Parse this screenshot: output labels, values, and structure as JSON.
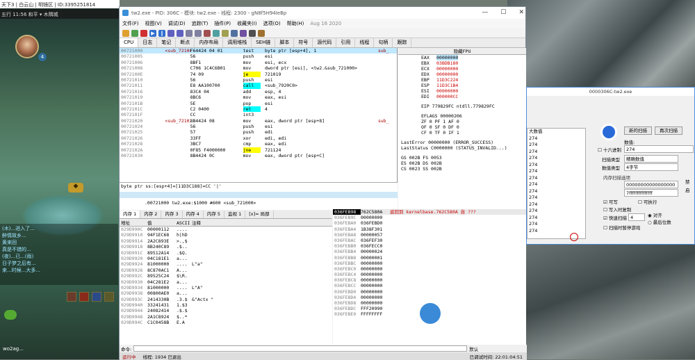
{
  "game": {
    "title": "天下3 | 白云山 | 明镜区 | ID:3395251814",
    "top_bar": "五行 11:56  和平 ▾  木隅城",
    "level": "4",
    "chat": [
      "(木)...进入了...",
      "醉情故乡...",
      "黄来回",
      "真是不错的...",
      "(夜)...已...(雨)",
      "日子梦之后有...",
      "来...时候...大多..."
    ],
    "player_name": "wo2ag..."
  },
  "dbg": {
    "title": "tw2.exe - PID: 306C - 模块: tw2.exe - 线程: 2300 - gN8f5H94IeBp",
    "date": "Aug 16 2020",
    "menu": [
      "文件(F)",
      "视图(V)",
      "调试(D)",
      "追踪(T)",
      "插件(P)",
      "收藏夹(I)",
      "选项(O)",
      "帮助(H)"
    ],
    "tabs": [
      "CPU",
      "日志",
      "笔记",
      "断点",
      "内存布局",
      "调用堆栈",
      "SEH链",
      "脚本",
      "符号",
      "源代码",
      "引用",
      "线程",
      "句柄",
      "跟踪"
    ],
    "disasm": [
      {
        "addr": "00721000",
        "label": "<sub_72100",
        "bytes": "F64424 04 01",
        "op": "test",
        "args": "byte ptr [esp+4], 1",
        "sub": "sub_",
        "sel": true,
        "hl": ""
      },
      {
        "addr": "00721005",
        "label": "",
        "bytes": "56",
        "op": "push",
        "args": "esi",
        "sub": "",
        "sel": false,
        "hl": ""
      },
      {
        "addr": "00721006",
        "label": "",
        "bytes": "8BF1",
        "op": "mov",
        "args": "esi, ecx",
        "sub": "",
        "sel": false,
        "hl": ""
      },
      {
        "addr": "00721008",
        "label": "",
        "bytes": "C706 1C4C6B01",
        "op": "mov",
        "args": "dword ptr [esi], <tw2.&sub_721000>",
        "sub": "",
        "sel": false,
        "hl": ""
      },
      {
        "addr": "0072100E",
        "label": "",
        "bytes": "74 09",
        "op": "je",
        "args": "721019",
        "sub": "",
        "sel": false,
        "hl": "j"
      },
      {
        "addr": "00721010",
        "label": "",
        "bytes": "56",
        "op": "push",
        "args": "esi",
        "sub": "",
        "sel": false,
        "hl": ""
      },
      {
        "addr": "00721011",
        "label": "",
        "bytes": "E8 AA100700",
        "op": "call",
        "args": "<sub_7920C0>",
        "sub": "",
        "sel": false,
        "hl": "call"
      },
      {
        "addr": "00721016",
        "label": "",
        "bytes": "83C4 04",
        "op": "add",
        "args": "esp, 4",
        "sub": "",
        "sel": false,
        "hl": ""
      },
      {
        "addr": "00721019",
        "label": "",
        "bytes": "8BC6",
        "op": "mov",
        "args": "eax, esi",
        "sub": "",
        "sel": false,
        "hl": ""
      },
      {
        "addr": "0072101B",
        "label": "",
        "bytes": "5E",
        "op": "pop",
        "args": "esi",
        "sub": "",
        "sel": false,
        "hl": ""
      },
      {
        "addr": "0072101C",
        "label": "",
        "bytes": "C2 0400",
        "op": "ret",
        "args": "4",
        "sub": "",
        "sel": false,
        "hl": "ret"
      },
      {
        "addr": "0072101F",
        "label": "",
        "bytes": "CC",
        "op": "int3",
        "args": "",
        "sub": "",
        "sel": false,
        "hl": ""
      },
      {
        "addr": "00721020",
        "label": "<sub_72102",
        "bytes": "8B4424 08",
        "op": "mov",
        "args": "eax, dword ptr [esp+8]",
        "sub": "sub_",
        "sel": false,
        "hl": ""
      },
      {
        "addr": "00721024",
        "label": "",
        "bytes": "56",
        "op": "push",
        "args": "esi",
        "sub": "",
        "sel": false,
        "hl": ""
      },
      {
        "addr": "00721025",
        "label": "",
        "bytes": "57",
        "op": "push",
        "args": "edi",
        "sub": "",
        "sel": false,
        "hl": ""
      },
      {
        "addr": "00721026",
        "label": "",
        "bytes": "33FF",
        "op": "xor",
        "args": "edi, edi",
        "sub": "",
        "sel": false,
        "hl": ""
      },
      {
        "addr": "00721028",
        "label": "",
        "bytes": "3BC7",
        "op": "cmp",
        "args": "eax, edi",
        "sub": "",
        "sel": false,
        "hl": ""
      },
      {
        "addr": "0072102A",
        "label": "",
        "bytes": "0F85 F4000000",
        "op": "jne",
        "args": "721124",
        "sub": "",
        "sel": false,
        "hl": "j"
      },
      {
        "addr": "00721030",
        "label": "",
        "bytes": "8B4424 0C",
        "op": "mov",
        "args": "eax, dword ptr [esp+C]",
        "sub": "",
        "sel": false,
        "hl": ""
      }
    ],
    "regs_header": "隐藏FPU",
    "regs": [
      {
        "n": "EAX",
        "v": "00000000"
      },
      {
        "n": "EBX",
        "v": "03BDB180"
      },
      {
        "n": "ECX",
        "v": "00000000"
      },
      {
        "n": "EDX",
        "v": "00000000"
      },
      {
        "n": "EBP",
        "v": "11D3C224"
      },
      {
        "n": "ESP",
        "v": "11D3C1B4"
      },
      {
        "n": "ESI",
        "v": "00000000"
      },
      {
        "n": "EDI",
        "v": "000000CC"
      }
    ],
    "eip": "EIP     779829FC     ntdll.779829FC",
    "eflags": "EFLAGS    00000206",
    "flags": [
      "ZF 0  PF 1  AF 0",
      "OF 0  SF 0  DF 0",
      "CF 0  TF 0  IF 1"
    ],
    "lasterror": "LastError   00000000 (ERROR_SUCCESS)",
    "laststatus": "LastStatus  C0000000 (STATUS_INVALID...)",
    "segs": [
      "GS 002B  FS 0053",
      "ES 002B  DS 002B",
      "CS 0023  SS 002B"
    ],
    "info1": "byte ptr ss:[esp+4]=[11D3C188]=CC '|'",
    "info2": ".00721000 tw2.exe:$1000 #600 <sub_721000>",
    "dump_tabs": [
      "内存 1",
      "内存 2",
      "内存 3",
      "内存 4",
      "内存 5",
      "监视 1",
      "[x]= 局部"
    ],
    "dump_head": [
      "地址",
      "值",
      "ASCII",
      "注释"
    ],
    "dump": [
      {
        "a": "029D990C",
        "h": "00000112",
        "s": "....",
        "c": ""
      },
      {
        "a": "029D9910",
        "h": "94F1EC68",
        "s": "h|hD",
        "c": ""
      },
      {
        "a": "029D9914",
        "h": "2A2C893E",
        "s": ">.,$",
        "c": ""
      },
      {
        "a": "029D9918",
        "h": "8B240C89",
        "s": ".$..",
        "c": ""
      },
      {
        "a": "029D991C",
        "h": "89512A14",
        "s": ".$Q.",
        "c": ""
      },
      {
        "a": "029D9920",
        "h": "04C181E1",
        "s": "a...",
        "c": ""
      },
      {
        "a": "029D9924",
        "h": "81000000",
        "s": "....",
        "c": "L\"a\""
      },
      {
        "a": "029D9928",
        "h": "8C870AC1",
        "s": "A...",
        "c": ""
      },
      {
        "a": "029D992C",
        "h": "89525C24",
        "s": "$\\R.",
        "c": ""
      },
      {
        "a": "029D9930",
        "h": "04C281E2",
        "s": "a...",
        "c": ""
      },
      {
        "a": "029D9934",
        "h": "81000000",
        "s": "....",
        "c": "L\"A\""
      },
      {
        "a": "029D9938",
        "h": "00800AE0",
        "s": "a...",
        "c": ""
      },
      {
        "a": "029D993C",
        "h": "2414330B",
        "s": ".3.$",
        "c": "&\"Actx \""
      },
      {
        "a": "029D9940",
        "h": "33241431",
        "s": "1.$3",
        "c": ""
      },
      {
        "a": "029D9944",
        "h": "24082414",
        "s": ".$.$",
        "c": ""
      },
      {
        "a": "029D9948",
        "h": "2A1C8924",
        "s": "$..*",
        "c": ""
      },
      {
        "a": "029D994C",
        "h": "C1C0458B",
        "s": "E.A",
        "c": ""
      }
    ],
    "stack": [
      {
        "a": "036FEB98",
        "v": "762C580A",
        "c": "返回到 kernelbase.762C580A 自 ???"
      },
      {
        "a": "036FEB9C",
        "v": "00000000",
        "c": ""
      },
      {
        "a": "036FEBA0",
        "v": "036FEBD0",
        "c": ""
      },
      {
        "a": "036FEBA4",
        "v": "1B38F301",
        "c": ""
      },
      {
        "a": "036FEBA8",
        "v": "00000057",
        "c": ""
      },
      {
        "a": "036FEBAC",
        "v": "036FEF30",
        "c": ""
      },
      {
        "a": "036FEBB0",
        "v": "036FECC0",
        "c": ""
      },
      {
        "a": "036FEBB4",
        "v": "00000024",
        "c": ""
      },
      {
        "a": "036FEBB8",
        "v": "00000001",
        "c": ""
      },
      {
        "a": "036FEBBC",
        "v": "00000000",
        "c": ""
      },
      {
        "a": "036FEBC0",
        "v": "00000000",
        "c": ""
      },
      {
        "a": "036FEBC4",
        "v": "00000000",
        "c": ""
      },
      {
        "a": "036FEBC8",
        "v": "00000000",
        "c": ""
      },
      {
        "a": "036FEBCC",
        "v": "00000000",
        "c": ""
      },
      {
        "a": "036FEBD0",
        "v": "00000000",
        "c": ""
      },
      {
        "a": "036FEBD4",
        "v": "00000000",
        "c": ""
      },
      {
        "a": "036FEBD8",
        "v": "00000000",
        "c": ""
      },
      {
        "a": "036FEBDC",
        "v": "FFF20990",
        "c": ""
      },
      {
        "a": "036FEBE0",
        "v": "FFFFFFFF",
        "c": ""
      }
    ],
    "cmd_label": "命令:",
    "cmd_default": "默认",
    "status": [
      "运行中",
      "线程: 1934 已退出"
    ],
    "status_right": "已调试时间: 22:01:04:51"
  },
  "ce": {
    "title": "0000306C-tw2.exe",
    "results": [
      "大数值",
      "274",
      "274",
      "274",
      "274",
      "274",
      "274",
      "274",
      "274",
      "274",
      "274",
      "274",
      "274",
      "274",
      "274",
      "274"
    ],
    "first_scan": "新的扫描",
    "next_scan": "再次扫描",
    "value_label": "数值:",
    "hex_label": "十六进制",
    "value": "274",
    "scan_type_label": "扫描类型",
    "scan_type": "精确数值",
    "value_type_label": "数值类型",
    "value_type": "4字节",
    "mem_opts": "内存扫描选项",
    "start": "00000000000000000",
    "stop": "7fffffffffffffff",
    "writable": "可写",
    "executable": "可执行",
    "copyonwrite": "写入时复制",
    "fast_scan": "快速扫描",
    "fast_val": "4",
    "align": "对齐",
    "last_digits": "最后位数",
    "pause": "扫描时暂停游戏",
    "side1": "禁",
    "side2": "启"
  }
}
